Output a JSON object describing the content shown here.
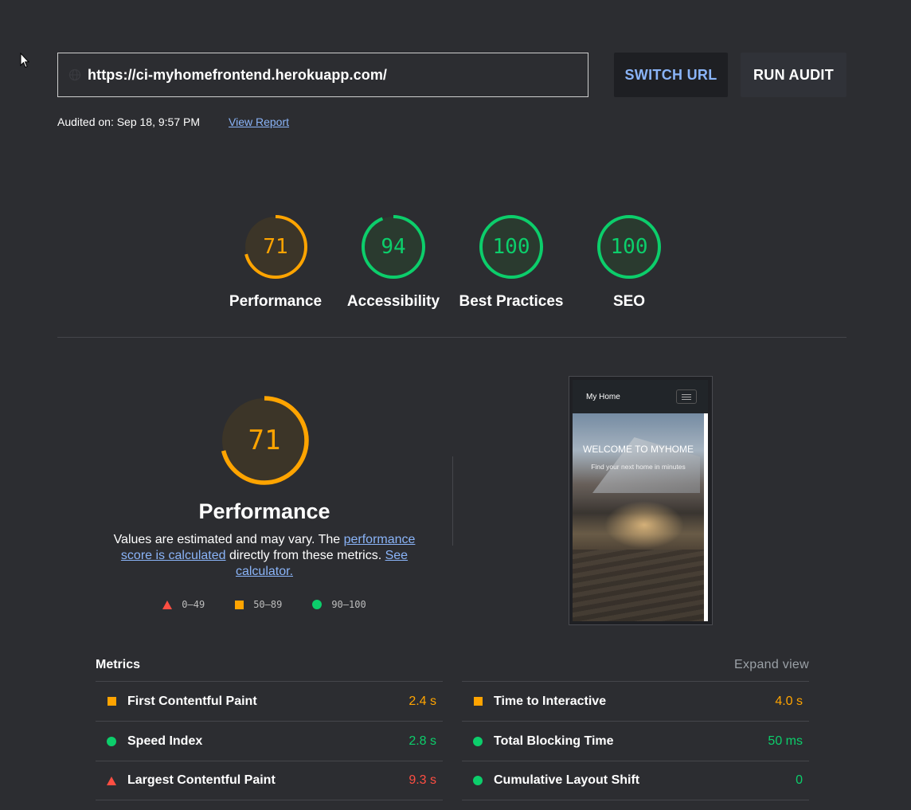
{
  "header": {
    "url": "https://ci-myhomefrontend.herokuapp.com/",
    "switch_url_label": "SWITCH URL",
    "run_audit_label": "RUN AUDIT",
    "audited_on": "Audited on: Sep 18, 9:57 PM",
    "view_report_label": "View Report"
  },
  "scores": [
    {
      "label": "Performance",
      "score": "71",
      "value": 71,
      "color": "#ffa400",
      "bg": "#3c3528"
    },
    {
      "label": "Accessibility",
      "score": "94",
      "value": 94,
      "color": "#0cce6b",
      "bg": "#2a3a2f"
    },
    {
      "label": "Best Practices",
      "score": "100",
      "value": 100,
      "color": "#0cce6b",
      "bg": "#2a3a2f"
    },
    {
      "label": "SEO",
      "score": "100",
      "value": 100,
      "color": "#0cce6b",
      "bg": "#2a3a2f"
    }
  ],
  "performance": {
    "score": "71",
    "value": 71,
    "title": "Performance",
    "desc_prefix": "Values are estimated and may vary. The ",
    "desc_link1": "performance score is calculated",
    "desc_middle": " directly from these metrics. ",
    "desc_link2": "See calculator.",
    "legend": [
      {
        "range": "0–49",
        "shape": "triangle",
        "color": "#ff4e42"
      },
      {
        "range": "50–89",
        "shape": "square",
        "color": "#ffa400"
      },
      {
        "range": "90–100",
        "shape": "circle",
        "color": "#0cce6b"
      }
    ]
  },
  "thumbnail": {
    "brand": "My Home",
    "hero_title": "WELCOME TO MYHOME",
    "hero_subtitle": "Find your next home in minutes"
  },
  "metrics": {
    "title": "Metrics",
    "expand_label": "Expand view",
    "left": [
      {
        "name": "First Contentful Paint",
        "value": "2.4 s",
        "status": "average"
      },
      {
        "name": "Speed Index",
        "value": "2.8 s",
        "status": "pass"
      },
      {
        "name": "Largest Contentful Paint",
        "value": "9.3 s",
        "status": "fail"
      }
    ],
    "right": [
      {
        "name": "Time to Interactive",
        "value": "4.0 s",
        "status": "average"
      },
      {
        "name": "Total Blocking Time",
        "value": "50 ms",
        "status": "pass"
      },
      {
        "name": "Cumulative Layout Shift",
        "value": "0",
        "status": "pass"
      }
    ]
  },
  "colors": {
    "pass": "#0cce6b",
    "average": "#ffa400",
    "fail": "#ff4e42",
    "link": "#8ab4f8"
  }
}
